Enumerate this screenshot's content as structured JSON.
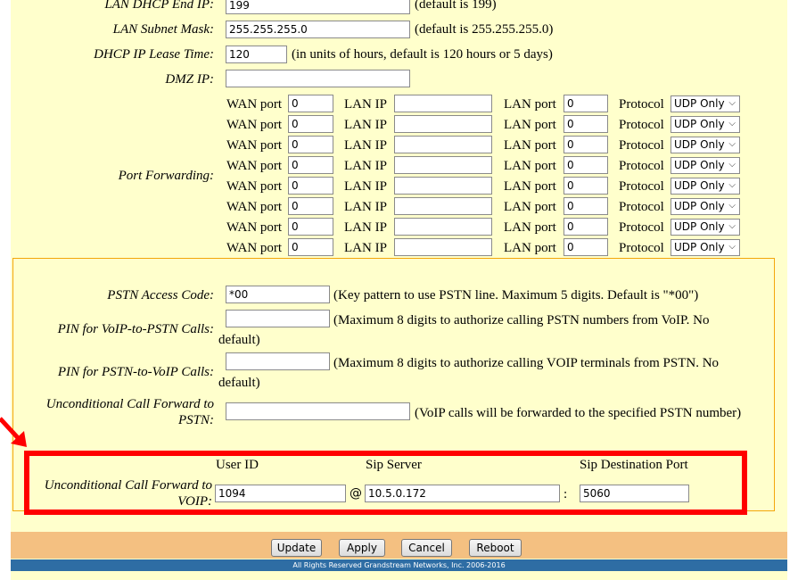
{
  "lan_settings": {
    "dhcp_end_label": "LAN DHCP End IP:",
    "dhcp_end_value": "199",
    "dhcp_end_hint": "(default is 199)",
    "subnet_label": "LAN Subnet Mask:",
    "subnet_value": "255.255.255.0",
    "subnet_hint": "(default is 255.255.255.0)",
    "lease_label": "DHCP IP Lease Time:",
    "lease_value": "120",
    "lease_hint": "(in units of hours, default is 120 hours or 5 days)",
    "dmz_label": "DMZ IP:",
    "dmz_value": ""
  },
  "port_forwarding": {
    "label": "Port Forwarding:",
    "wan_port_label": "WAN port",
    "lan_ip_label": "LAN IP",
    "lan_port_label": "LAN port",
    "protocol_label": "Protocol",
    "rows": [
      {
        "wan_port": "0",
        "lan_ip": "",
        "lan_port": "0",
        "protocol": "UDP Only"
      },
      {
        "wan_port": "0",
        "lan_ip": "",
        "lan_port": "0",
        "protocol": "UDP Only"
      },
      {
        "wan_port": "0",
        "lan_ip": "",
        "lan_port": "0",
        "protocol": "UDP Only"
      },
      {
        "wan_port": "0",
        "lan_ip": "",
        "lan_port": "0",
        "protocol": "UDP Only"
      },
      {
        "wan_port": "0",
        "lan_ip": "",
        "lan_port": "0",
        "protocol": "UDP Only"
      },
      {
        "wan_port": "0",
        "lan_ip": "",
        "lan_port": "0",
        "protocol": "UDP Only"
      },
      {
        "wan_port": "0",
        "lan_ip": "",
        "lan_port": "0",
        "protocol": "UDP Only"
      },
      {
        "wan_port": "0",
        "lan_ip": "",
        "lan_port": "0",
        "protocol": "UDP Only"
      }
    ]
  },
  "pstn": {
    "access_code_label": "PSTN Access Code:",
    "access_code_value": "*00",
    "access_code_hint": "(Key pattern to use PSTN line. Maximum 5 digits. Default is \"*00\")",
    "voip_to_pstn_label": "PIN for VoIP-to-PSTN Calls:",
    "voip_to_pstn_value": "",
    "voip_to_pstn_hint_a": "(Maximum 8 digits to authorize calling PSTN numbers from VoIP.  No",
    "voip_to_pstn_hint_b": "default)",
    "pstn_to_voip_label": "PIN for PSTN-to-VoIP Calls:",
    "pstn_to_voip_value": "",
    "pstn_to_voip_hint_a": "(Maximum 8 digits to authorize calling VOIP terminals from PSTN.  No",
    "pstn_to_voip_hint_b": "default)",
    "fwd_pstn_label_a": "Unconditional Call Forward to",
    "fwd_pstn_label_b": "PSTN:",
    "fwd_pstn_value": "",
    "fwd_pstn_hint": "(VoIP calls will be forwarded to the specified PSTN number)"
  },
  "voip_forward": {
    "user_id_header": "User ID",
    "sip_server_header": "Sip Server",
    "sip_port_header": "Sip Destination Port",
    "label_a": "Unconditional Call Forward to",
    "label_b": "VOIP:",
    "user_id": "1094",
    "at_sign": "@",
    "sip_server": "10.5.0.172",
    "colon": ":",
    "sip_port": "5060"
  },
  "buttons": {
    "update": "Update",
    "apply": "Apply",
    "cancel": "Cancel",
    "reboot": "Reboot"
  },
  "footer": "All Rights Reserved Grandstream Networks, Inc. 2006-2016",
  "colors": {
    "panel_bg": "#ffffcc",
    "highlight_border": "#ff0000",
    "section_border": "#f3a60a",
    "button_bar": "#f4c081",
    "footer_bg": "#2e6da4"
  }
}
